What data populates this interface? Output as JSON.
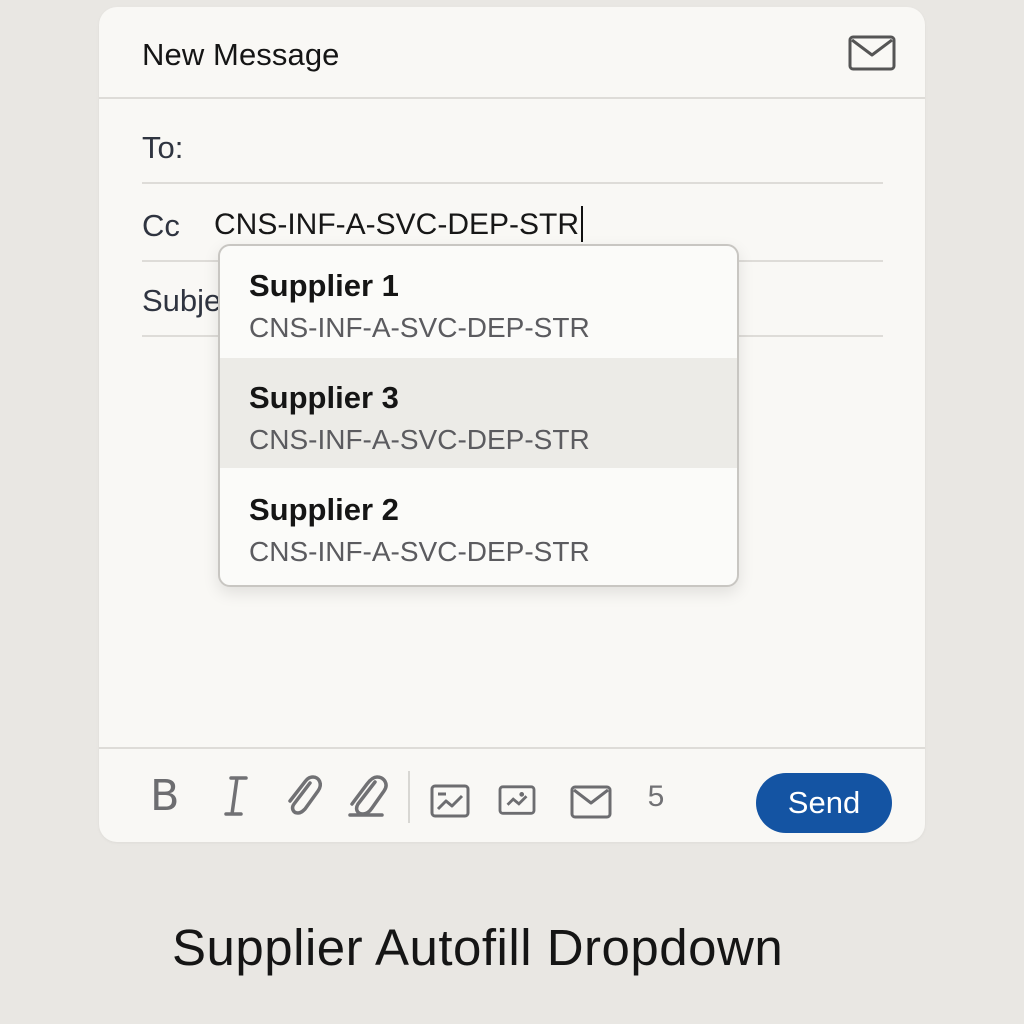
{
  "compose": {
    "title": "New Message",
    "fields": {
      "to_label": "To:",
      "to_value": "",
      "cc_label": "Cc",
      "cc_value": "CNS-INF-A-SVC-DEP-STR",
      "subject_label": "Subje"
    }
  },
  "dropdown": {
    "items": [
      {
        "name": "Supplier 1",
        "email": "CNS-INF-A-SVC-DEP-STR",
        "highlighted": false
      },
      {
        "name": "Supplier 3",
        "email": "CNS-INF-A-SVC-DEP-STR",
        "highlighted": true
      },
      {
        "name": "Supplier 2",
        "email": "CNS-INF-A-SVC-DEP-STR",
        "highlighted": false
      }
    ]
  },
  "toolbar": {
    "bold_label": "B",
    "italic_icon": "italic-icon",
    "attachment_icons": [
      "paperclip-icon",
      "paperclip-icon"
    ],
    "image_icons": [
      "image-icon",
      "image-icon"
    ],
    "mail_icon": "envelope-icon",
    "number_label": "5",
    "send_label": "Send"
  },
  "caption": "Supplier Autofill Dropdown",
  "colors": {
    "accent": "#1454a3",
    "background": "#e9e7e3",
    "panel": "#f9f8f5",
    "highlight": "#ecebe7"
  }
}
